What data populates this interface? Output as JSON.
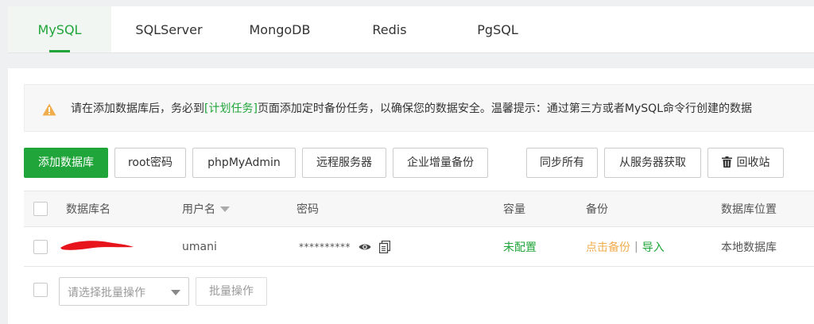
{
  "tabs": [
    {
      "label": "MySQL",
      "active": true
    },
    {
      "label": "SQLServer",
      "active": false
    },
    {
      "label": "MongoDB",
      "active": false
    },
    {
      "label": "Redis",
      "active": false
    },
    {
      "label": "PgSQL",
      "active": false
    }
  ],
  "notice": {
    "icon": "warning-icon",
    "text_before": "请在添加数据库后，务必到",
    "link": "[计划任务]",
    "text_after": "页面添加定时备份任务，以确保您的数据安全。温馨提示：通过第三方或者MySQL命令行创建的数据"
  },
  "toolbar": {
    "add_database": "添加数据库",
    "root_password": "root密码",
    "phpmyadmin": "phpMyAdmin",
    "remote_server": "远程服务器",
    "enterprise_backup": "企业增量备份",
    "sync_all": "同步所有",
    "fetch_from_server": "从服务器获取",
    "recycle_bin": "回收站"
  },
  "table": {
    "headers": {
      "db_name": "数据库名",
      "username": "用户名",
      "password": "密码",
      "capacity": "容量",
      "backup": "备份",
      "location": "数据库位置"
    },
    "rows": [
      {
        "db_name": "",
        "username": "umani",
        "password": "**********",
        "capacity": "未配置",
        "backup_action": "点击备份",
        "backup_sep": "|",
        "import_action": "导入",
        "location": "本地数据库"
      }
    ]
  },
  "footer": {
    "batch_select_placeholder": "请选择批量操作",
    "batch_button": "批量操作"
  },
  "colors": {
    "accent": "#20a53a",
    "warning": "#f0ad4e",
    "redaction": "#e8141c"
  }
}
